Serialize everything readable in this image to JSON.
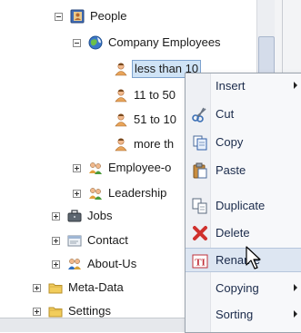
{
  "tree": {
    "nodes": [
      {
        "id": "people",
        "label": "People",
        "expander": "minus"
      },
      {
        "id": "company-employees",
        "label": "Company Employees",
        "expander": "minus"
      },
      {
        "id": "less-than-10",
        "label": "less than 10",
        "selected": true
      },
      {
        "id": "11-to-50",
        "label": "11 to 50"
      },
      {
        "id": "51-to-100",
        "label": "51 to 10"
      },
      {
        "id": "more-than",
        "label": "more th"
      },
      {
        "id": "employee-of",
        "label": "Employee-o",
        "expander": "plus"
      },
      {
        "id": "leadership",
        "label": "Leadership",
        "expander": "plus"
      },
      {
        "id": "jobs",
        "label": "Jobs",
        "expander": "plus"
      },
      {
        "id": "contact",
        "label": "Contact",
        "expander": "plus"
      },
      {
        "id": "about-us",
        "label": "About-Us",
        "expander": "plus"
      },
      {
        "id": "meta-data",
        "label": "Meta-Data",
        "expander": "plus"
      },
      {
        "id": "settings",
        "label": "Settings",
        "expander": "plus"
      }
    ]
  },
  "context_menu": {
    "items": [
      {
        "label": "Insert",
        "icon": "none",
        "submenu": true
      },
      {
        "label": "Cut",
        "icon": "scissors-icon"
      },
      {
        "label": "Copy",
        "icon": "copy-icon"
      },
      {
        "label": "Paste",
        "icon": "paste-icon"
      },
      {
        "label": "Duplicate",
        "icon": "duplicate-icon"
      },
      {
        "label": "Delete",
        "icon": "delete-x-icon"
      },
      {
        "label": "Rename",
        "icon": "rename-icon",
        "hover": true
      },
      {
        "label": "Copying",
        "icon": "none",
        "submenu": true
      },
      {
        "label": "Sorting",
        "icon": "none",
        "submenu": true
      }
    ]
  },
  "colors": {
    "selection_bg": "#cfe3f6",
    "menu_hover": "#dde6f2",
    "menu_text": "#1a2a4a",
    "delete_red": "#d0312d"
  }
}
